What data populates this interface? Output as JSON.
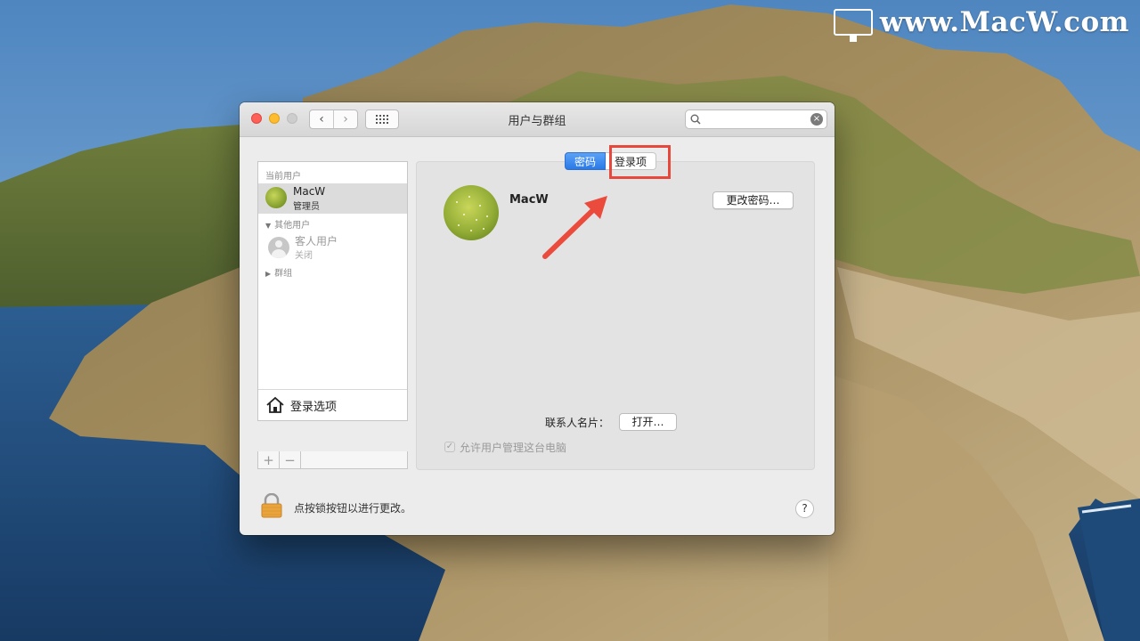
{
  "watermark": {
    "text": "www.MacW.com"
  },
  "window": {
    "title": "用户与群组",
    "nav": {
      "back_glyph": "‹",
      "forward_glyph": "›"
    },
    "search": {
      "placeholder": "",
      "clear_glyph": "×"
    }
  },
  "sidebar": {
    "current_header": "当前用户",
    "current_user": {
      "name": "MacW",
      "role": "管理员"
    },
    "other_header": "其他用户",
    "guest": {
      "name": "客人用户",
      "status": "关闭"
    },
    "groups_header": "群组",
    "login_options": "登录选项",
    "add_glyph": "+",
    "remove_glyph": "−"
  },
  "tabs": [
    {
      "label": "密码",
      "active": true
    },
    {
      "label": "登录项",
      "active": false
    }
  ],
  "user": {
    "name": "MacW",
    "change_password_button": "更改密码…"
  },
  "contact": {
    "label": "联系人名片：",
    "open_button": "打开…"
  },
  "admin_checkbox": {
    "label": "允许用户管理这台电脑",
    "checked": true,
    "check_glyph": "✓"
  },
  "lock": {
    "label": "点按锁按钮以进行更改。"
  },
  "help": {
    "glyph": "?"
  },
  "colors": {
    "accent": "#2a79e6",
    "highlight": "#e8473c",
    "arrow": "#ea4b3d"
  }
}
